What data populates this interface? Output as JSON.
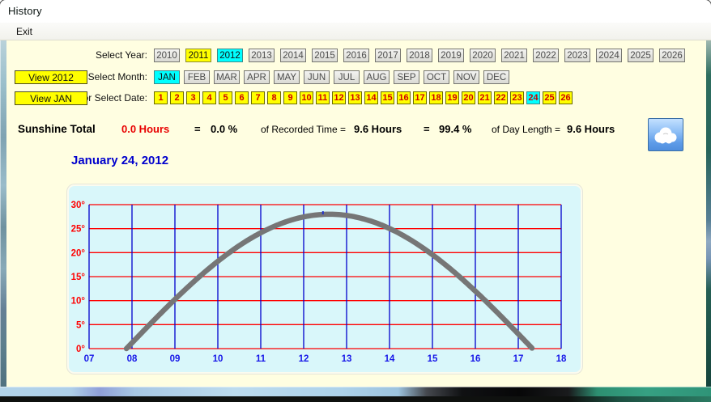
{
  "window": {
    "title": "History"
  },
  "menu_bar": {
    "exit_label": "Exit"
  },
  "selectors": {
    "year": {
      "label": "Select Year:",
      "options": [
        "2010",
        "2011",
        "2012",
        "2013",
        "2014",
        "2015",
        "2016",
        "2017",
        "2018",
        "2019",
        "2020",
        "2021",
        "2022",
        "2023",
        "2024",
        "2025",
        "2026"
      ],
      "highlight_yellow": "2011",
      "highlight_cyan": "2012"
    },
    "month": {
      "view_button": "View 2012",
      "label": "or Select Month:",
      "options": [
        "JAN",
        "FEB",
        "MAR",
        "APR",
        "MAY",
        "JUN",
        "JUL",
        "AUG",
        "SEP",
        "OCT",
        "NOV",
        "DEC"
      ],
      "highlight_cyan": "JAN"
    },
    "date": {
      "view_button": "View JAN",
      "label": "or Select Date:",
      "options": [
        "1",
        "2",
        "3",
        "4",
        "5",
        "6",
        "7",
        "8",
        "9",
        "10",
        "11",
        "12",
        "13",
        "14",
        "15",
        "16",
        "17",
        "18",
        "19",
        "20",
        "21",
        "22",
        "23",
        "24",
        "25",
        "26"
      ],
      "highlight_cyan": "24"
    }
  },
  "summary": {
    "title": "Sunshine Total",
    "sunshine_hours": "0.0 Hours",
    "eq1": "=",
    "recorded_pct": "0.0 %",
    "recorded_label": "of Recorded Time =",
    "recorded_hours": "9.6 Hours",
    "eq2": "=",
    "daylength_pct": "99.4 %",
    "daylength_label": "of Day Length =",
    "daylength_hours": "9.6 Hours",
    "weather_icon": "cloud-icon"
  },
  "chart_heading": "January 24, 2012",
  "chart_data": {
    "type": "line",
    "title": "January 24, 2012",
    "x_ticks": [
      "07",
      "08",
      "09",
      "10",
      "11",
      "12",
      "13",
      "14",
      "15",
      "16",
      "17",
      "18"
    ],
    "x_range": [
      7,
      18
    ],
    "y_ticks": [
      "0°",
      "5°",
      "10°",
      "15°",
      "20°",
      "25°",
      "30°"
    ],
    "y_range": [
      0,
      30
    ],
    "y_step": 5,
    "grid": {
      "horizontal_color": "#ff0000",
      "vertical_color": "#0000cd",
      "background": "#d9f7fa",
      "x_label_color": "#1717e8",
      "y_label_color": "#ff0000"
    },
    "legend": false,
    "series": [
      {
        "name": "solar-elevation",
        "color": "#767676",
        "stroke_width": 6.5,
        "sunrise_hour": 7.87,
        "sunset_hour": 17.33,
        "peak_elevation_deg": 28,
        "peak_hour": 12.6,
        "noon_mark_hour": 12.45,
        "hourly_elevation_deg": {
          "08": 1.2,
          "09": 10.3,
          "10": 18.2,
          "11": 24.1,
          "12": 27.4,
          "13": 27.8,
          "14": 25.1,
          "15": 19.6,
          "16": 12.0,
          "17": 3.1
        }
      }
    ]
  },
  "colors": {
    "highlight_yellow": "#ffff00",
    "highlight_cyan": "#00ffff",
    "date_text_red": "#cf0000",
    "client_bg": "#fffee1"
  }
}
